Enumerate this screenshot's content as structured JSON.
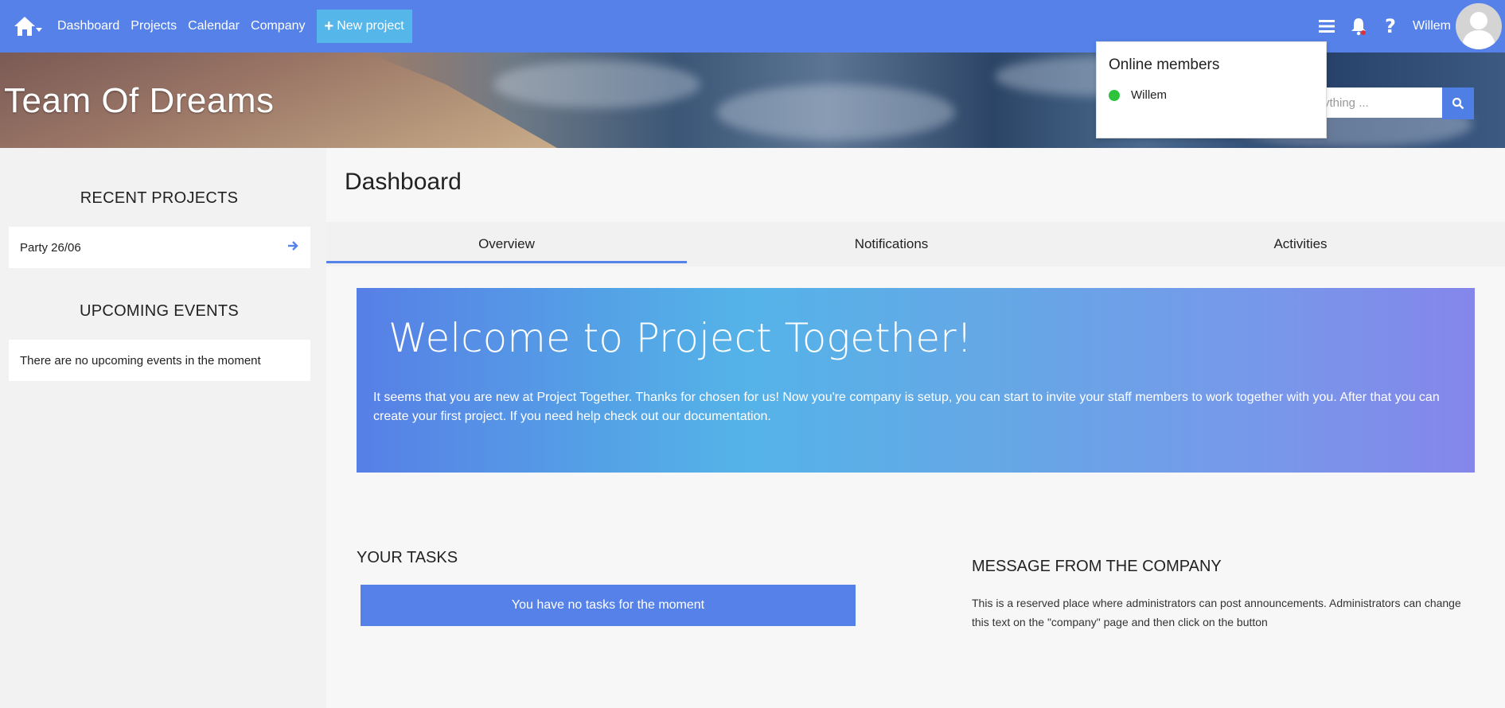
{
  "topbar": {
    "nav": [
      "Dashboard",
      "Projects",
      "Calendar",
      "Company"
    ],
    "new_project_label": "New project",
    "username": "Willem",
    "color": "#5581e8"
  },
  "banner": {
    "team_name": "Team Of Dreams",
    "search_placeholder": "ything ..."
  },
  "online_popup": {
    "title": "Online members",
    "members": [
      {
        "name": "Willem",
        "status_color": "#2ec23d"
      }
    ]
  },
  "sidebar": {
    "recent_projects_heading": "RECENT PROJECTS",
    "recent_projects": [
      {
        "name": "Party 26/06"
      }
    ],
    "upcoming_events_heading": "UPCOMING EVENTS",
    "upcoming_events_empty": "There are no upcoming events in the moment"
  },
  "main": {
    "title": "Dashboard",
    "tabs": [
      {
        "label": "Overview",
        "active": true
      },
      {
        "label": "Notifications",
        "active": false
      },
      {
        "label": "Activities",
        "active": false
      }
    ],
    "welcome": {
      "heading": "Welcome to Project Together!",
      "text": "It seems that you are new at Project Together. Thanks for chosen for us! Now you're company is setup, you can start to invite your staff members to work together with you. After that you can create your first project. If you need help check out our documentation."
    },
    "tasks": {
      "heading": "YOUR TASKS",
      "empty": "You have no tasks for the moment"
    },
    "company_message": {
      "heading": "MESSAGE FROM THE COMPANY",
      "text": "This is a reserved place where administrators can post announcements. Administrators can change this text on the \"company\" page and then click on the button"
    }
  }
}
